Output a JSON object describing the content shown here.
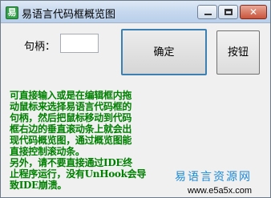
{
  "window": {
    "title": "易语言代码框概览图",
    "app_icon": "易",
    "controls": {
      "minimize": "minimize",
      "maximize": "maximize",
      "close": "✕"
    }
  },
  "form": {
    "handle_label": "句柄：",
    "handle_value": "",
    "confirm_label": "确定",
    "button_label": "按钮"
  },
  "notice": {
    "lines": [
      "可直接输入或是在编辑框内拖",
      "动鼠标来选择易语言代码框的",
      "句柄，然后把鼠标移动到代码",
      "框右边的垂直滚动条上就会出",
      "现代码概览图，通过概览图能",
      "直接控制滚动条。",
      "另外，请不要直接通过IDE终",
      "止程序运行，没有UnHook会导",
      "致IDE崩溃。"
    ],
    "color": "#008000"
  },
  "watermark": {
    "site_name": "易语言资源网",
    "url": "www.e5a5x.com",
    "color": "#1f8ad6"
  }
}
